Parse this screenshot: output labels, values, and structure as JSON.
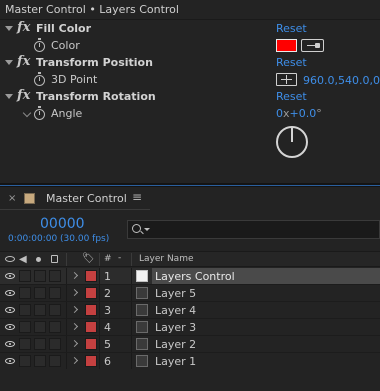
{
  "panel_header": {
    "title": "Master Control • Layers Control"
  },
  "effects": [
    {
      "name": "Fill Color",
      "reset": "Reset",
      "property": {
        "name": "Color",
        "value_color": "#ff0000"
      }
    },
    {
      "name": "Transform Position",
      "reset": "Reset",
      "property": {
        "name": "3D Point",
        "value": "960.0,540.0,0.0"
      }
    },
    {
      "name": "Transform Rotation",
      "reset": "Reset",
      "property": {
        "name": "Angle",
        "revolutions": "0",
        "x_sep": "x",
        "degrees": "+0.0",
        "deg_symbol": "°"
      }
    }
  ],
  "timeline": {
    "tab_close": "×",
    "tab_title": "Master Control",
    "tab_menu": "≡",
    "timecode": "00000",
    "timecode_sub": "0:00:00:00 (30.00 fps)",
    "search_placeholder": "",
    "columns": {
      "label_icon": "🏷",
      "number": "#",
      "dash": "-",
      "layer_name": "Layer Name"
    },
    "layers": [
      {
        "num": "1",
        "name": "Layers Control",
        "label_color": "#c44040",
        "selected": true
      },
      {
        "num": "2",
        "name": "Layer 5",
        "label_color": "#c44040",
        "selected": false
      },
      {
        "num": "3",
        "name": "Layer 4",
        "label_color": "#c44040",
        "selected": false
      },
      {
        "num": "4",
        "name": "Layer 3",
        "label_color": "#c44040",
        "selected": false
      },
      {
        "num": "5",
        "name": "Layer 2",
        "label_color": "#c44040",
        "selected": false
      },
      {
        "num": "6",
        "name": "Layer 1",
        "label_color": "#c44040",
        "selected": false
      }
    ]
  },
  "colors": {
    "accent_blue": "#3e8ee8",
    "label_red": "#c44040",
    "swatch_red": "#ff0000"
  }
}
